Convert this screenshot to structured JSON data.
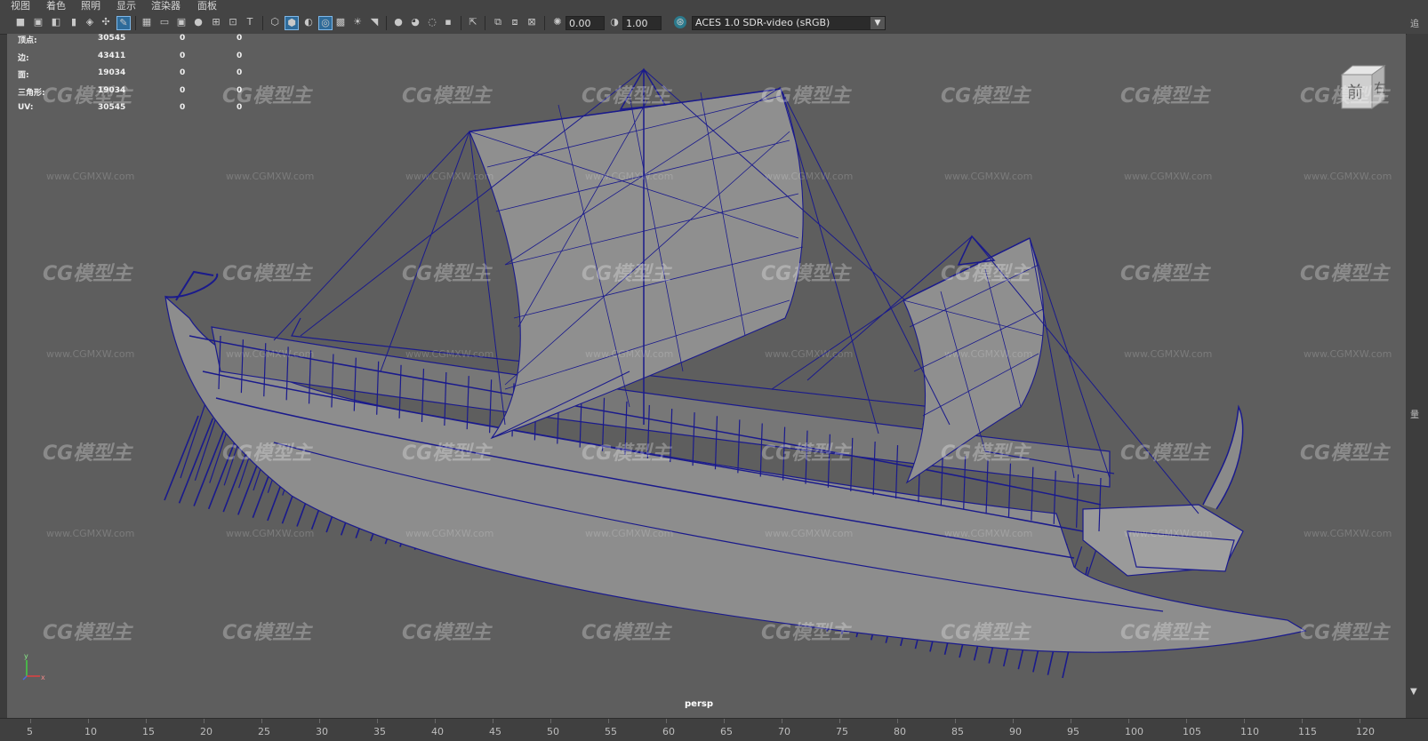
{
  "menu": [
    "视图",
    "着色",
    "照明",
    "显示",
    "渲染器",
    "面板"
  ],
  "toolbar": {
    "value_a": "0.00",
    "value_b": "1.00",
    "colorspace": "ACES 1.0 SDR-video (sRGB)"
  },
  "hud": [
    {
      "label": "顶点:",
      "count": "30545",
      "a": "0",
      "b": "0"
    },
    {
      "label": "边:",
      "count": "43411",
      "a": "0",
      "b": "0"
    },
    {
      "label": "面:",
      "count": "19034",
      "a": "0",
      "b": "0"
    },
    {
      "label": "三角形:",
      "count": "19034",
      "a": "0",
      "b": "0"
    },
    {
      "label": "UV:",
      "count": "30545",
      "a": "0",
      "b": "0"
    }
  ],
  "viewcube": {
    "front": "前",
    "right": "右"
  },
  "camera": "persp",
  "watermark": {
    "logo": "CG模型主",
    "url": "www.CGMXW.com"
  },
  "timeline": [
    "5",
    "10",
    "15",
    "20",
    "25",
    "30",
    "35",
    "40",
    "45",
    "50",
    "55",
    "60",
    "65",
    "70",
    "75",
    "80",
    "85",
    "90",
    "95",
    "100",
    "105",
    "110",
    "115",
    "120"
  ],
  "right_strip": [
    "追",
    "量"
  ],
  "axis": {
    "x": "x",
    "y": "y"
  },
  "colors": {
    "wire": "#1a1a8c",
    "viewport": "#5e5e5e",
    "mesh": "#8a8a8a"
  }
}
